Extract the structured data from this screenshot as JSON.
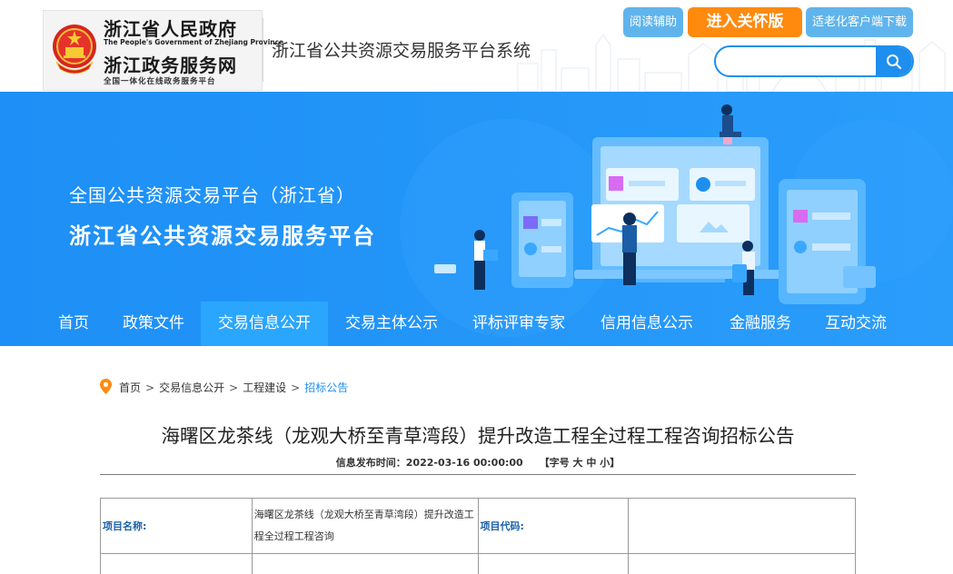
{
  "header": {
    "gov_name_cn": "浙江省人民政府",
    "gov_name_en": "The People's Government of Zhejiang Province",
    "service_name_cn": "浙江政务服务网",
    "service_tagline": "全国一体化在线政务服务平台",
    "site_title": "浙江省公共资源交易服务平台系统",
    "buttons": {
      "reading_aid": "阅读辅助",
      "care_mode": "进入关怀版",
      "elderly_client": "适老化客户端下载"
    },
    "search": {
      "value": "",
      "placeholder": ""
    }
  },
  "banner": {
    "line1": "全国公共资源交易平台（浙江省）",
    "line2": "浙江省公共资源交易服务平台"
  },
  "nav": {
    "items": [
      {
        "label": "首页",
        "active": false
      },
      {
        "label": "政策文件",
        "active": false
      },
      {
        "label": "交易信息公开",
        "active": true
      },
      {
        "label": "交易主体公示",
        "active": false
      },
      {
        "label": "评标评审专家",
        "active": false
      },
      {
        "label": "信用信息公示",
        "active": false
      },
      {
        "label": "金融服务",
        "active": false
      },
      {
        "label": "互动交流",
        "active": false
      }
    ]
  },
  "breadcrumb": {
    "items": [
      "首页",
      "交易信息公开",
      "工程建设",
      "招标公告"
    ],
    "separator": ">"
  },
  "article": {
    "title": "海曙区龙茶线（龙观大桥至青草湾段）提升改造工程全过程工程咨询招标公告",
    "publish_label": "信息发布时间：",
    "publish_time": "2022-03-16 00:00:00",
    "font_size_label": "【字号",
    "font_large": "大",
    "font_medium": "中",
    "font_small": "小",
    "font_size_close": "】"
  },
  "info_table": {
    "project_name_label": "项目名称:",
    "project_name_value": "海曙区龙茶线（龙观大桥至青草湾段）提升改造工程全过程工程咨询",
    "project_code_label": "项目代码:",
    "project_code_value": ""
  },
  "colors": {
    "banner_blue": "#1f95fa",
    "nav_active": "#2aa6ff",
    "care_orange": "#ff8a0e",
    "aux_button_blue": "#60b4ec",
    "search_blue": "#1e8fee",
    "table_label_blue": "#1b60a8"
  }
}
